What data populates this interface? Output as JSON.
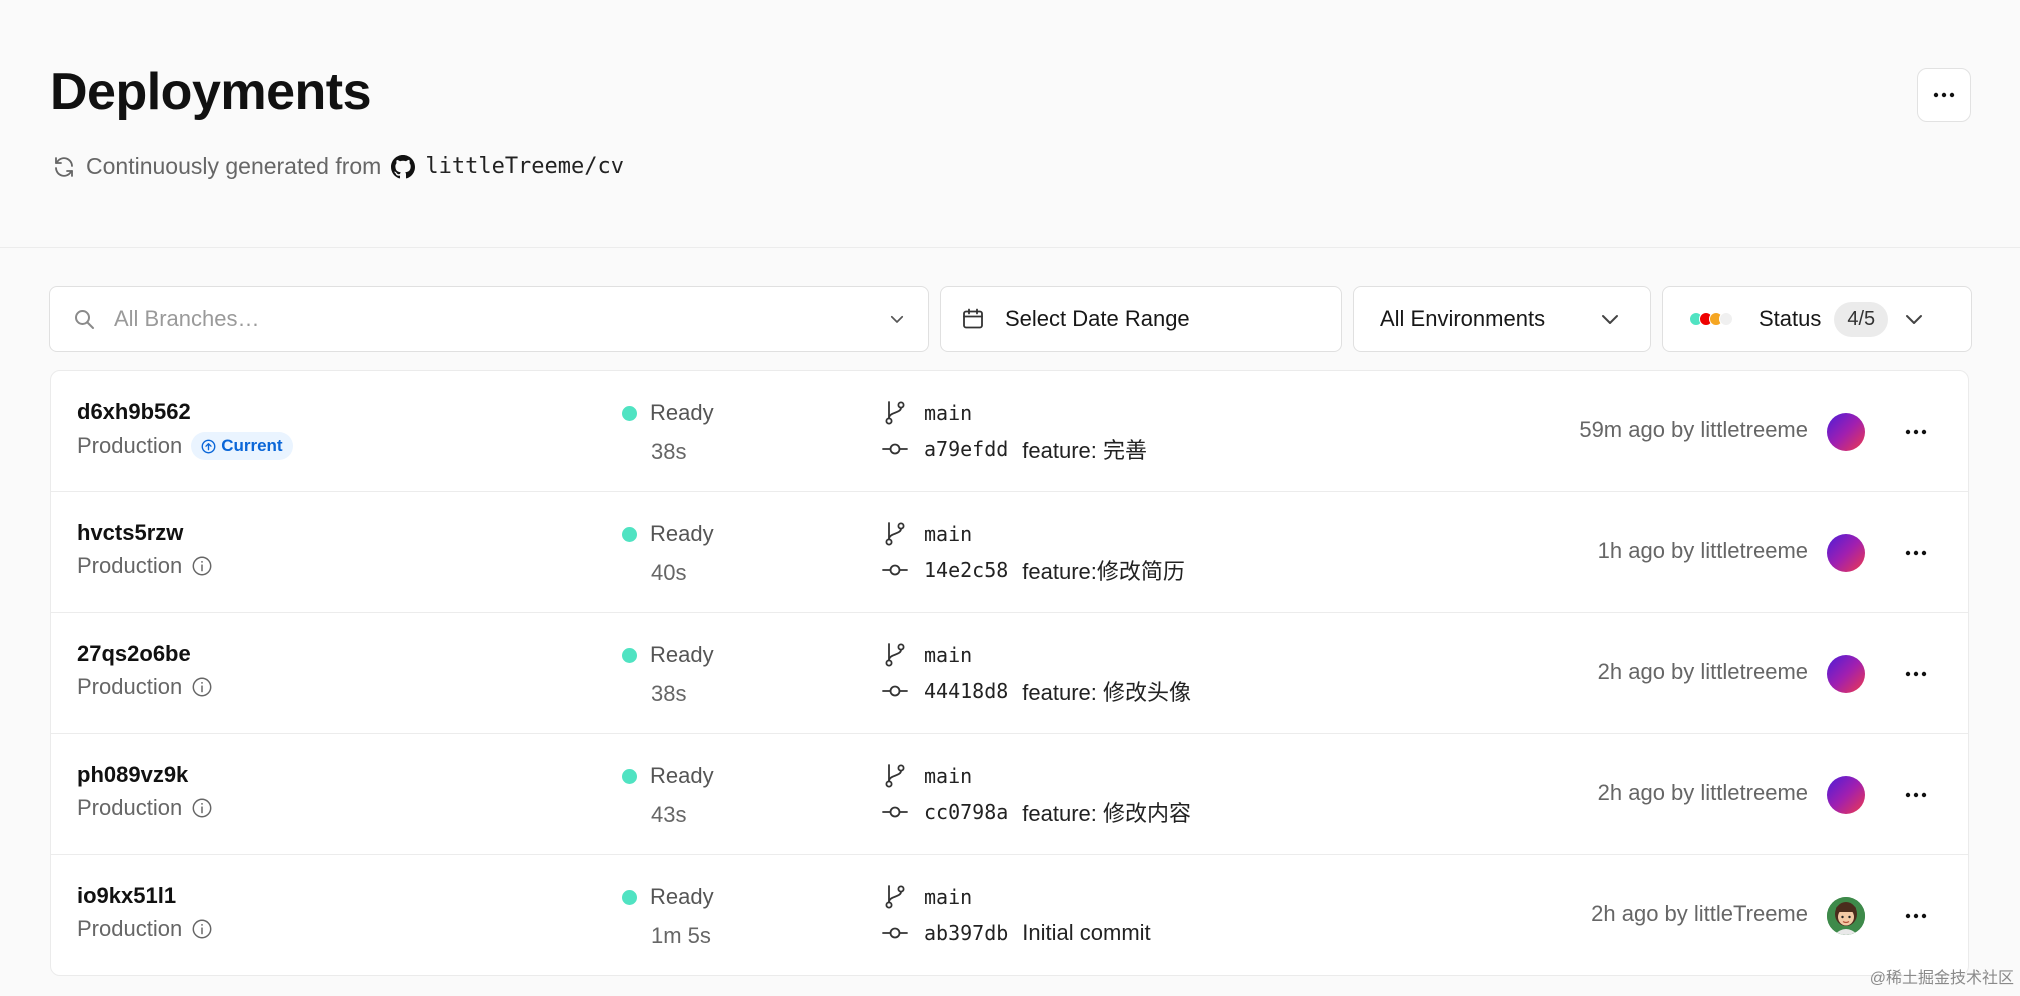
{
  "header": {
    "title": "Deployments",
    "subtitle_prefix": "Continuously generated from",
    "repo": "littleTreeme/cv",
    "sync_icon": "refresh-icon",
    "repo_icon": "github-icon",
    "menu_icon": "more-horizontal-icon"
  },
  "filters": {
    "branch_placeholder": "All Branches…",
    "date_label": "Select Date Range",
    "environment_label": "All Environments",
    "status_label": "Status",
    "status_count": "4/5",
    "status_colors": [
      "#50e3c2",
      "#ee0000",
      "#f5a623",
      "#f0f0f0"
    ]
  },
  "deployments": [
    {
      "id": "d6xh9b562",
      "environment": "Production",
      "badge": "Current",
      "status": "Ready",
      "duration": "38s",
      "branch": "main",
      "commit": "a79efdd",
      "message": "feature: 完善",
      "meta": "59m ago by littletreeme",
      "avatar": "gradient"
    },
    {
      "id": "hvcts5rzw",
      "environment": "Production",
      "badge": "",
      "status": "Ready",
      "duration": "40s",
      "branch": "main",
      "commit": "14e2c58",
      "message": "feature:修改简历",
      "meta": "1h ago by littletreeme",
      "avatar": "gradient"
    },
    {
      "id": "27qs2o6be",
      "environment": "Production",
      "badge": "",
      "status": "Ready",
      "duration": "38s",
      "branch": "main",
      "commit": "44418d8",
      "message": "feature: 修改头像",
      "meta": "2h ago by littletreeme",
      "avatar": "gradient"
    },
    {
      "id": "ph089vz9k",
      "environment": "Production",
      "badge": "",
      "status": "Ready",
      "duration": "43s",
      "branch": "main",
      "commit": "cc0798a",
      "message": "feature: 修改内容",
      "meta": "2h ago by littletreeme",
      "avatar": "gradient"
    },
    {
      "id": "io9kx51l1",
      "environment": "Production",
      "badge": "",
      "status": "Ready",
      "duration": "1m 5s",
      "branch": "main",
      "commit": "ab397db",
      "message": "Initial commit",
      "meta": "2h ago by littleTreeme",
      "avatar": "photo"
    }
  ],
  "watermark": "@稀土掘金技术社区"
}
